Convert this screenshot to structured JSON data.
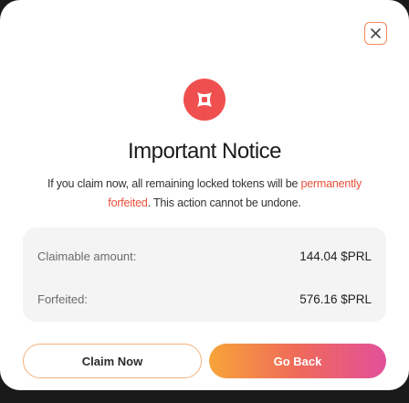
{
  "dialog": {
    "title": "Important Notice",
    "message_before": "If you claim now, all remaining locked tokens will be ",
    "message_highlight": "permanently forfeited",
    "message_after": ". This action cannot be undone.",
    "details": [
      {
        "label": "Claimable amount:",
        "value": "144.04 $PRL"
      },
      {
        "label": "Forfeited:",
        "value": "576.16 $PRL"
      }
    ],
    "claim_label": "Claim Now",
    "back_label": "Go Back",
    "close_icon": "close-icon",
    "alert_icon": "alert-icon"
  },
  "colors": {
    "accent_orange": "#f08a5d",
    "alert_red": "#f04f4f",
    "warning_text": "#e8503a",
    "gradient_start": "#f7a43a",
    "gradient_end": "#e2509a"
  }
}
